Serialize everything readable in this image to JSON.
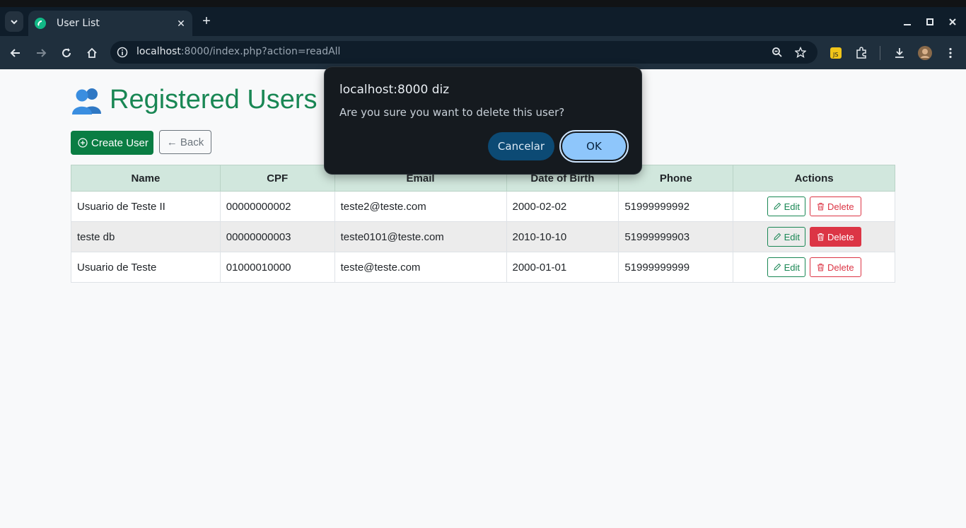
{
  "browser": {
    "tab_title": "User List",
    "url_host": "localhost",
    "url_rest": ":8000/index.php?action=readAll"
  },
  "page": {
    "title": "Registered Users",
    "create_button": "Create User",
    "back_button": "← Back",
    "table": {
      "headers": [
        "Name",
        "CPF",
        "Email",
        "Date of Birth",
        "Phone",
        "Actions"
      ],
      "rows": [
        {
          "name": "Usuario de Teste II",
          "cpf": "00000000002",
          "email": "teste2@teste.com",
          "dob": "2000-02-02",
          "phone": "51999999992"
        },
        {
          "name": "teste db",
          "cpf": "00000000003",
          "email": "teste0101@teste.com",
          "dob": "2010-10-10",
          "phone": "51999999903"
        },
        {
          "name": "Usuario de Teste",
          "cpf": "01000010000",
          "email": "teste@teste.com",
          "dob": "2000-01-01",
          "phone": "51999999999"
        }
      ],
      "edit_label": "Edit",
      "delete_label": "Delete"
    }
  },
  "dialog": {
    "title": "localhost:8000 diz",
    "message": "Are you sure you want to delete this user?",
    "cancel_label": "Cancelar",
    "ok_label": "OK"
  },
  "colors": {
    "accent_green": "#198754",
    "danger_red": "#dc3545",
    "header_bg": "#d1e7dd",
    "dialog_ok": "#8ec6fb"
  }
}
